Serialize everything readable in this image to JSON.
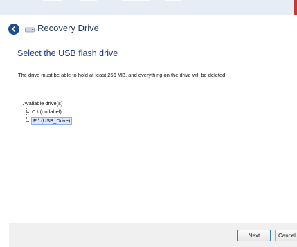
{
  "window": {
    "title": "Recovery Drive",
    "colors": {
      "close_accent": "#c33a33",
      "back_button": "#1f4e8f",
      "heading": "#1f3a8a"
    }
  },
  "page": {
    "heading": "Select the USB flash drive",
    "description": "The drive must be able to hold at least 256 MB, and everything on the drive will be deleted."
  },
  "drives": {
    "label": "Available drive(s)",
    "items": [
      {
        "label": "C:\\ (no label)",
        "selected": false
      },
      {
        "label": "E:\\ (USB_Drive)",
        "selected": true
      }
    ]
  },
  "footer": {
    "next_label": "Next",
    "cancel_label": "Cancel"
  }
}
